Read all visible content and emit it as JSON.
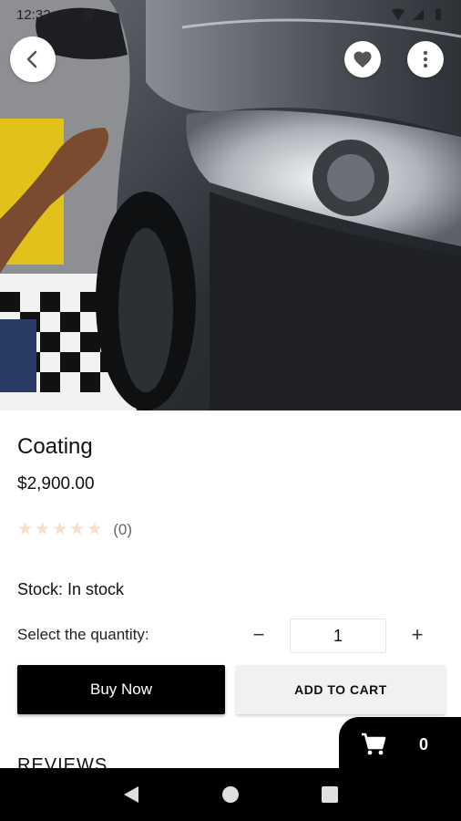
{
  "status_bar": {
    "time": "12:32"
  },
  "product": {
    "title": "Coating",
    "price": "$2,900.00",
    "rating_stars": 0,
    "rating_count": "(0)",
    "stock_text": "Stock: In stock"
  },
  "quantity": {
    "label": "Select the quantity:",
    "minus": "−",
    "value": "1",
    "plus": "+"
  },
  "actions": {
    "buy_now": "Buy Now",
    "add_to_cart": "ADD TO CART"
  },
  "reviews": {
    "heading": "REVIEWS"
  },
  "cart": {
    "count": "0"
  },
  "icons": {
    "back": "chevron-left-icon",
    "favorite": "heart-icon",
    "more": "more-vertical-icon",
    "cart": "shopping-cart-icon",
    "nav_back": "triangle-back-icon",
    "nav_home": "circle-home-icon",
    "nav_recents": "square-recents-icon"
  },
  "colors": {
    "primary": "#000000",
    "secondary_button": "#f0f1f3",
    "star_empty": "#f6dfc4"
  }
}
